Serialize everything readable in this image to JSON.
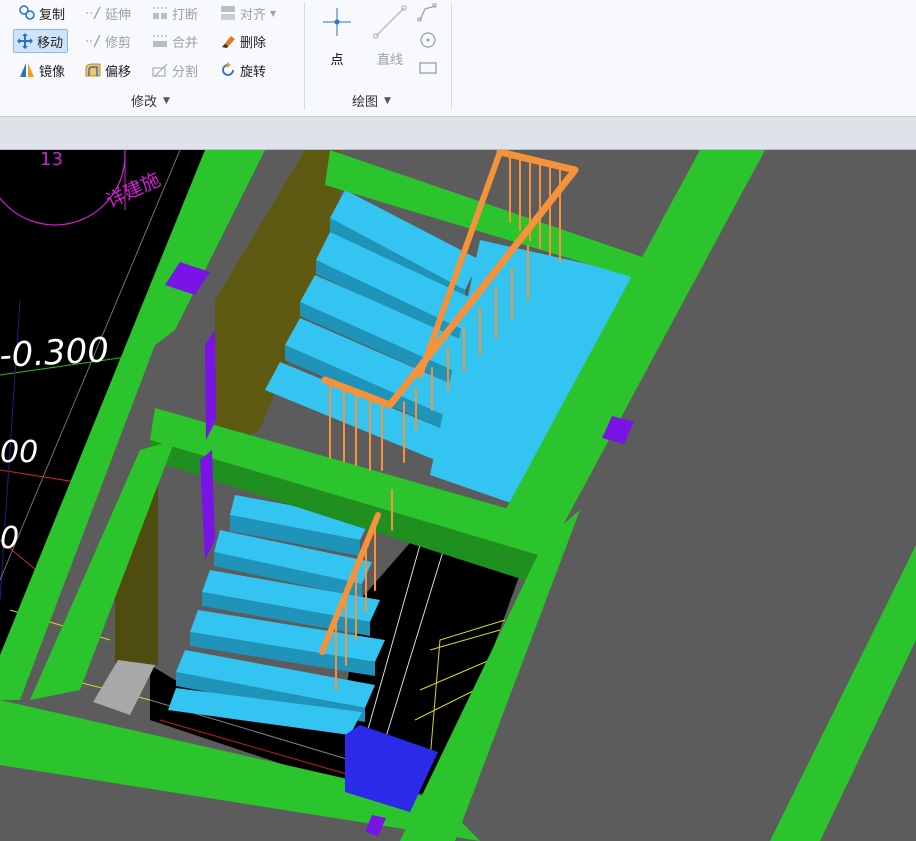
{
  "ribbon": {
    "modify_group": {
      "label": "修改",
      "tools": {
        "copy": "复制",
        "extend": "延伸",
        "break": "打断",
        "align": "对齐",
        "move": "移动",
        "trim": "修剪",
        "merge": "合并",
        "delete": "删除",
        "mirror": "镜像",
        "offset": "偏移",
        "split": "分割",
        "rotate": "旋转"
      }
    },
    "draw_group": {
      "label": "绘图",
      "tools": {
        "point": "点",
        "line": "直线"
      }
    }
  },
  "viewport": {
    "cad_texts": {
      "elev_a": "-0.300",
      "elev_b": "00",
      "elev_c": "0",
      "note_a": "详建施",
      "note_b": "13"
    },
    "colors": {
      "background": "#5c5c5c",
      "wall": "#2cc42c",
      "wall_dark": "#1f8f1f",
      "stair": "#33c4f2",
      "stair_dark": "#1f93b8",
      "railing": "#f5923a",
      "column": "#7a14e6",
      "block": "#2a2ae8",
      "cad_black": "#000000"
    }
  }
}
